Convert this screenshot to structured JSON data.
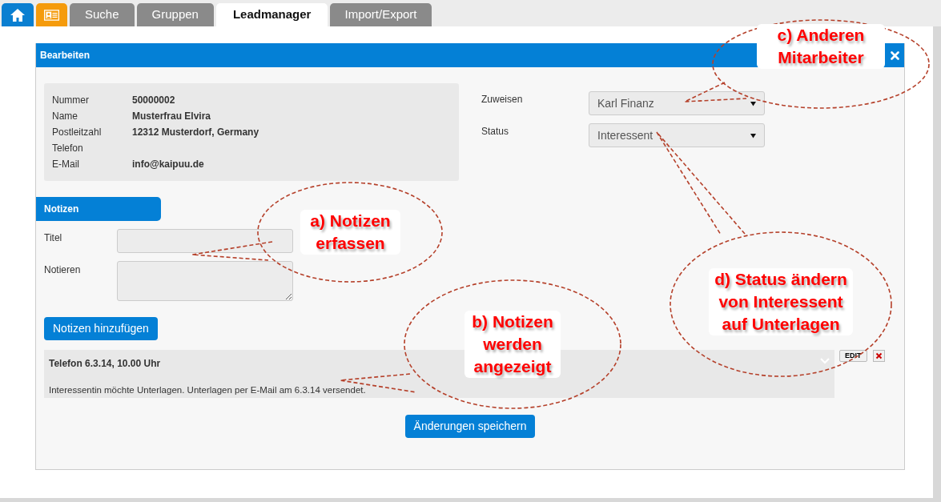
{
  "tabs": [
    {
      "kind": "home",
      "selected": false
    },
    {
      "kind": "contact",
      "selected": false
    },
    {
      "kind": "text",
      "label": "Suche",
      "selected": false
    },
    {
      "kind": "text",
      "label": "Gruppen",
      "selected": false
    },
    {
      "kind": "text",
      "label": "Leadmanager",
      "selected": true
    },
    {
      "kind": "text",
      "label": "Import/Export",
      "selected": false
    }
  ],
  "panel": {
    "title": "Bearbeiten"
  },
  "contact": [
    {
      "label": "Nummer",
      "value": "50000002"
    },
    {
      "label": "Name",
      "value": "Musterfrau Elvira"
    },
    {
      "label": "Postleitzahl",
      "value": "12312 Musterdorf, Germany"
    },
    {
      "label": "Telefon"
    },
    {
      "label": "E-Mail",
      "value": "info@kaipuu.de"
    }
  ],
  "selects": [
    {
      "label": "Zuweisen",
      "value": "Karl Finanz"
    },
    {
      "label": "Status",
      "value": "Interessent"
    }
  ],
  "notes_section": {
    "title": "Notizen",
    "fields": [
      {
        "kind": "input",
        "label": "Titel"
      },
      {
        "kind": "textarea",
        "label": "Notieren"
      }
    ],
    "add_button": "Notizen hinzufügen"
  },
  "notes": [
    {
      "title": "Telefon 6.3.14, 10.00 Uhr",
      "text": "Interessentin möchte Unterlagen. Unterlagen per E-Mail am 6.3.14 versendet.",
      "edit": "EDIT"
    }
  ],
  "save_button": "Änderungen speichern",
  "callouts": [
    {
      "text": "a) Notizen\nerfassen"
    },
    {
      "text": "b) Notizen\nwerden\nangezeigt"
    },
    {
      "text": "c) Anderen\nMitarbeiter"
    },
    {
      "text": "d) Status ändern\nvon Interessent\nauf Unterlagen"
    }
  ]
}
